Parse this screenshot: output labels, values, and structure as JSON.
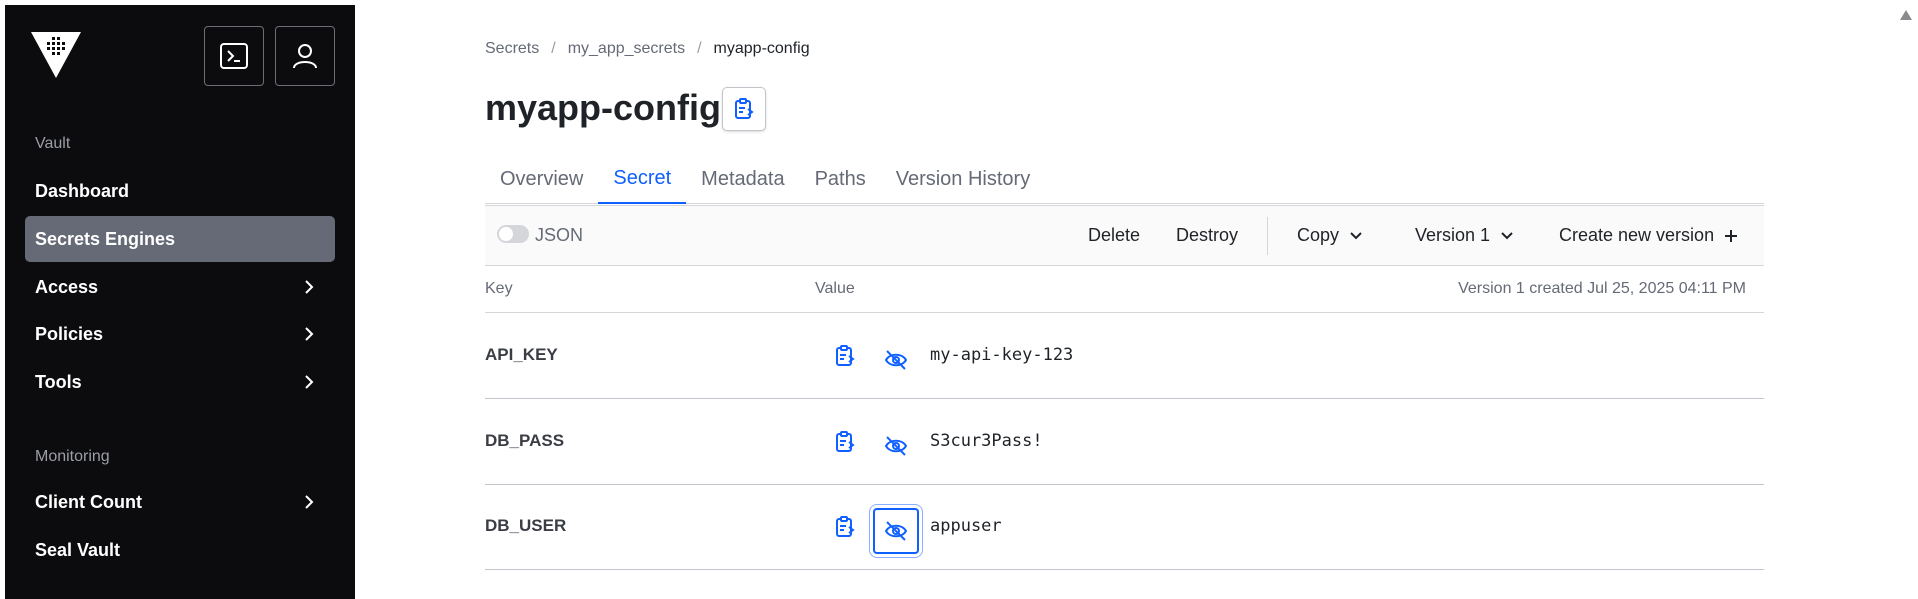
{
  "sidebar": {
    "section_vault": "Vault",
    "items": [
      {
        "label": "Dashboard",
        "has_chevron": false
      },
      {
        "label": "Secrets Engines",
        "active": true,
        "has_chevron": false
      },
      {
        "label": "Access",
        "has_chevron": true
      },
      {
        "label": "Policies",
        "has_chevron": true
      },
      {
        "label": "Tools",
        "has_chevron": true
      }
    ],
    "section_monitoring": "Monitoring",
    "monitoring_items": [
      {
        "label": "Client Count",
        "has_chevron": true
      },
      {
        "label": "Seal Vault",
        "has_chevron": false
      }
    ],
    "header_icons": [
      "terminal-icon",
      "user-icon"
    ]
  },
  "breadcrumb": {
    "items": [
      "Secrets",
      "my_app_secrets",
      "myapp-config"
    ],
    "separator": "/"
  },
  "page": {
    "title": "myapp-config"
  },
  "tabs": [
    "Overview",
    "Secret",
    "Metadata",
    "Paths",
    "Version History"
  ],
  "active_tab": "Secret",
  "toolbar": {
    "json_label": "JSON",
    "json_enabled": false,
    "delete_label": "Delete",
    "destroy_label": "Destroy",
    "copy_label": "Copy",
    "version_label": "Version 1",
    "create_label": "Create new version"
  },
  "table": {
    "key_header": "Key",
    "value_header": "Value",
    "meta": "Version 1 created Jul 25, 2025 04:11 PM",
    "rows": [
      {
        "key": "API_KEY",
        "value": "my-api-key-123"
      },
      {
        "key": "DB_PASS",
        "value": "S3cur3Pass!"
      },
      {
        "key": "DB_USER",
        "value": "appuser",
        "focused": true
      }
    ]
  },
  "colors": {
    "accent": "#1060ff",
    "sidebar_bg": "#0c0c0e",
    "sidebar_active": "#656a76"
  }
}
